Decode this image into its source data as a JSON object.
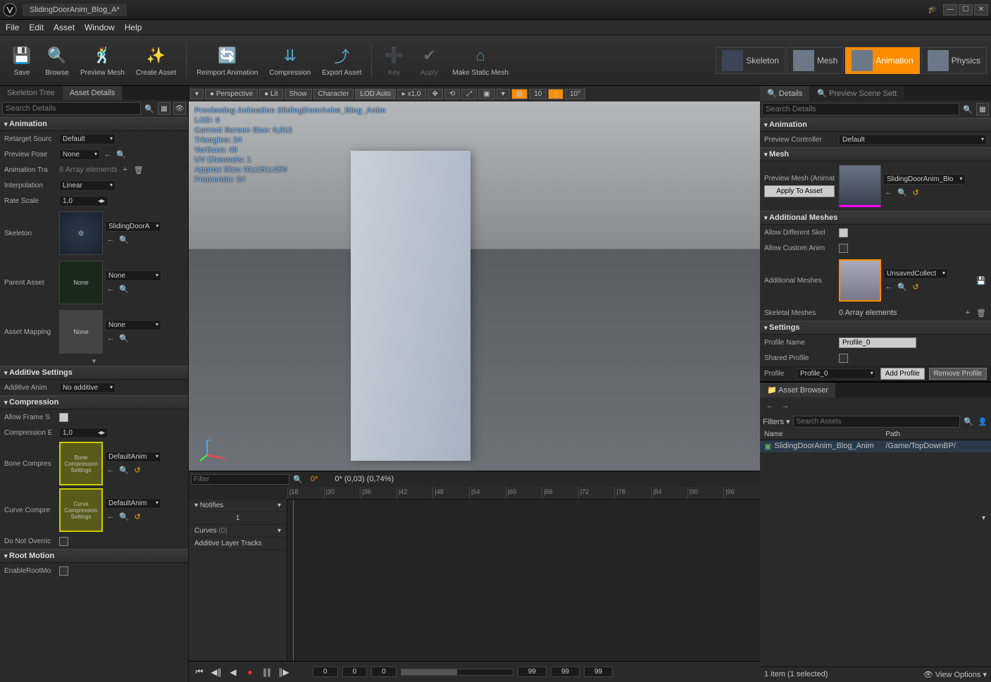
{
  "titlebar": {
    "tab": "SlidingDoorAnim_Blog_A*"
  },
  "menu": [
    "File",
    "Edit",
    "Asset",
    "Window",
    "Help"
  ],
  "toolbar": {
    "save": "Save",
    "browse": "Browse",
    "previewMesh": "Preview Mesh",
    "createAsset": "Create Asset",
    "reimport": "Reimport Animation",
    "compression": "Compression",
    "exportAsset": "Export Asset",
    "key": "Key",
    "apply": "Apply",
    "makeStatic": "Make Static Mesh"
  },
  "modes": {
    "skeleton": "Skeleton",
    "mesh": "Mesh",
    "animation": "Animation",
    "physics": "Physics"
  },
  "leftTabs": {
    "skeletonTree": "Skeleton Tree",
    "assetDetails": "Asset Details"
  },
  "search": {
    "placeholder": "Search Details"
  },
  "anim": {
    "hdr": "Animation",
    "retargetSource": {
      "lbl": "Retarget Sourc",
      "val": "Default"
    },
    "previewPose": {
      "lbl": "Preview Pose",
      "val": "None"
    },
    "animTracks": {
      "lbl": "Animation Tra",
      "val": "6 Array elements"
    },
    "interpolation": {
      "lbl": "Interpolation",
      "val": "Linear"
    },
    "rateScale": {
      "lbl": "Rate Scale",
      "val": "1,0"
    },
    "skeleton": {
      "lbl": "Skeleton",
      "val": "SlidingDoorA"
    },
    "parentAsset": {
      "lbl": "Parent Asset",
      "val": "None",
      "thumb": "None"
    },
    "assetMapping": {
      "lbl": "Asset Mapping",
      "val": "None",
      "thumb": "None"
    }
  },
  "additive": {
    "hdr": "Additive Settings",
    "lbl": "Additive Anim",
    "val": "No additive"
  },
  "compression": {
    "hdr": "Compression",
    "allowFrame": "Allow Frame S",
    "compressionE": {
      "lbl": "Compression E",
      "val": "1,0"
    },
    "boneComp": {
      "lbl": "Bone Compres",
      "val": "DefaultAnim",
      "thumb": "Bone Compression Settings"
    },
    "curveComp": {
      "lbl": "Curve Compre",
      "val": "DefaultAnim",
      "thumb": "Curve Compression Settings"
    },
    "doNotOverride": "Do Not Overric"
  },
  "rootMotion": {
    "hdr": "Root Motion",
    "enable": "EnableRootMo"
  },
  "viewport": {
    "buttons": {
      "perspective": "Perspective",
      "lit": "Lit",
      "show": "Show",
      "character": "Character",
      "lodAuto": "LOD Auto",
      "speed": "x1,0",
      "angle1": "10",
      "angle2": "10°"
    },
    "overlay": {
      "l1": "Previewing Animation SlidingDoorAnim_Blog_Anim",
      "l2": "LOD: 0",
      "l3": "Current Screen Size: 0,812",
      "l4": "Triangles: 24",
      "l5": "Vertices: 48",
      "l6": "UV Channels: 1",
      "l7": "Approx Size: 91x151x250",
      "l8": "Framerate: 24"
    }
  },
  "timeline": {
    "filter": "Filter",
    "zero": "0*",
    "scrub": "0* (0,03) (0,74%)",
    "ticks": [
      "|18",
      "|30",
      "|36",
      "|42",
      "|48",
      "|54",
      "|60",
      "|66",
      "|72",
      "|78",
      "|84",
      "|90",
      "|96"
    ],
    "notifies": "Notifies",
    "one": "1",
    "curves": "Curves",
    "curvesCount": "(0)",
    "additiveTracks": "Additive Layer Tracks",
    "frames": {
      "a": "0",
      "b": "0",
      "c": "0",
      "d": "99",
      "e": "99",
      "f": "99"
    }
  },
  "right": {
    "tabs": {
      "details": "Details",
      "preview": "Preview Scene Sett"
    },
    "search": "Search Details",
    "anim": {
      "hdr": "Animation",
      "previewController": {
        "lbl": "Preview Controller",
        "val": "Default"
      }
    },
    "mesh": {
      "hdr": "Mesh",
      "lbl": "Preview Mesh (Animation)",
      "apply": "Apply To Asset",
      "val": "SlidingDoorAnim_Blo"
    },
    "additionalMeshes": {
      "hdr": "Additional Meshes",
      "allowDiff": "Allow Different Skel",
      "allowCustom": "Allow Custom Anim",
      "lbl": "Additional Meshes",
      "val": "UnsavedCollect",
      "skeletalMeshes": {
        "lbl": "Skeletal Meshes",
        "val": "0 Array elements"
      }
    },
    "settings": {
      "hdr": "Settings",
      "profileName": {
        "lbl": "Profile Name",
        "val": "Profile_0"
      },
      "sharedProfile": "Shared Profile"
    },
    "profile": {
      "lbl": "Profile",
      "val": "Profile_0",
      "add": "Add Profile",
      "remove": "Remove Profile"
    }
  },
  "assetBrowser": {
    "hdr": "Asset Browser",
    "filters": "Filters",
    "search": "Search Assets",
    "cols": {
      "name": "Name",
      "path": "Path"
    },
    "row": {
      "name": "SlidingDoorAnim_Blog_Anim",
      "path": "/Game/TopDownBP/"
    },
    "footer": {
      "count": "1 item (1 selected)",
      "viewOptions": "View Options"
    }
  }
}
